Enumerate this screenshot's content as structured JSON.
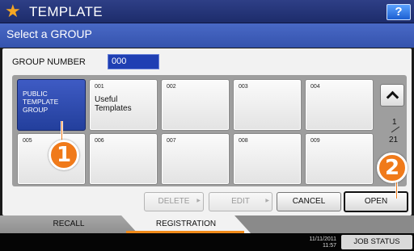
{
  "header": {
    "title": "TEMPLATE",
    "help_label": "?",
    "subtitle": "Select a GROUP"
  },
  "group_number": {
    "label": "GROUP NUMBER",
    "value": "000"
  },
  "groups": [
    {
      "num": "",
      "name": "PUBLIC TEMPLATE GROUP",
      "selected": true
    },
    {
      "num": "001",
      "name": "Useful Templates"
    },
    {
      "num": "002",
      "name": ""
    },
    {
      "num": "003",
      "name": ""
    },
    {
      "num": "004",
      "name": ""
    },
    {
      "num": "005",
      "name": ""
    },
    {
      "num": "006",
      "name": ""
    },
    {
      "num": "007",
      "name": ""
    },
    {
      "num": "008",
      "name": ""
    },
    {
      "num": "009",
      "name": ""
    }
  ],
  "pagination": {
    "current": "1",
    "total": "21"
  },
  "buttons": {
    "delete": "DELETE",
    "edit": "EDIT",
    "cancel": "CANCEL",
    "open": "OPEN"
  },
  "callouts": {
    "one": "1",
    "two": "2"
  },
  "tabs": {
    "recall": "RECALL",
    "registration": "REGISTRATION"
  },
  "status": {
    "date": "11/11/2011",
    "time": "11:57",
    "job_status": "JOB STATUS"
  },
  "colors": {
    "accent": "#f07a1a",
    "selected_tile": "#2d4bb0",
    "header": "#2e3f86"
  }
}
